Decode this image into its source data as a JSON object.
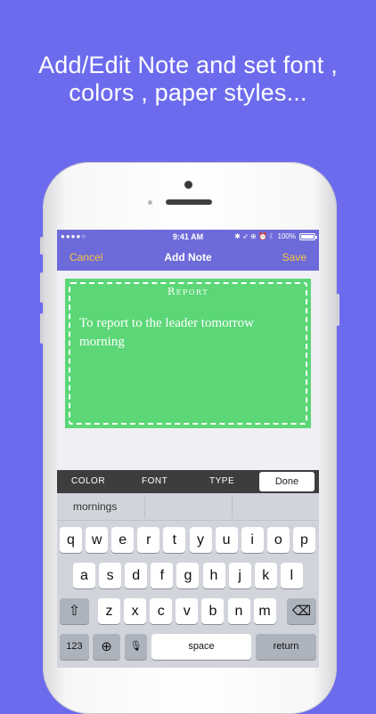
{
  "headline": {
    "line1": "Add/Edit Note and set font ,",
    "line2": "colors , paper styles..."
  },
  "statusbar": {
    "signal": "●●●●○ ",
    "time": "9:41 AM",
    "right": "✱ ➶ ⊕ ⏰ ☾ 100%"
  },
  "navbar": {
    "cancel": "Cancel",
    "title": "Add Note",
    "save": "Save"
  },
  "note": {
    "title": "Report",
    "body": "To report to the leader tomorrow morning",
    "color": "#5cd777"
  },
  "toolbar": {
    "color": "COLOR",
    "font": "FONT",
    "type": "TYPE",
    "done": "Done"
  },
  "keyboard": {
    "suggestion": "mornings",
    "row1": [
      "q",
      "w",
      "e",
      "r",
      "t",
      "y",
      "u",
      "i",
      "o",
      "p"
    ],
    "row2": [
      "a",
      "s",
      "d",
      "f",
      "g",
      "h",
      "j",
      "k",
      "l"
    ],
    "row3": [
      "z",
      "x",
      "c",
      "v",
      "b",
      "n",
      "m"
    ],
    "numbers": "123",
    "space": "space",
    "return": "return"
  },
  "colors": {
    "background": "#6c6bee",
    "navbar": "#6d6bd9",
    "accent": "#f4c542"
  }
}
